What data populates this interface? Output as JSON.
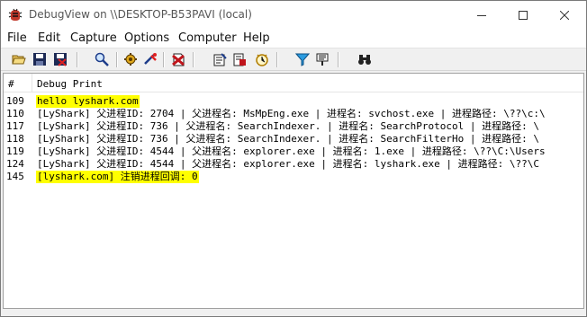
{
  "window": {
    "title": "DebugView on \\\\DESKTOP-B53PAVI (local)"
  },
  "menu": [
    "File",
    "Edit",
    "Capture",
    "Options",
    "Computer",
    "Help"
  ],
  "toolbar": {
    "buttons": [
      {
        "icon": "open-folder-icon"
      },
      {
        "icon": "save-icon"
      },
      {
        "icon": "save-as-icon"
      },
      {
        "icon": "find-icon"
      },
      {
        "icon": "capture-gear-icon"
      },
      {
        "icon": "capture-kernel-icon"
      },
      {
        "icon": "clear-icon"
      },
      {
        "icon": "properties-icon"
      },
      {
        "icon": "log-to-file-icon"
      },
      {
        "icon": "time-icon"
      },
      {
        "icon": "filter-icon"
      },
      {
        "icon": "highlight-icon"
      },
      {
        "icon": "binoculars-icon"
      }
    ]
  },
  "list": {
    "columns": [
      "#",
      "Debug Print"
    ],
    "rows": [
      {
        "num": "109",
        "text": "hello lyshark.com",
        "highlight": true
      },
      {
        "num": "110",
        "text": "[LyShark] 父进程ID: 2704 | 父进程名: MsMpEng.exe | 进程名: svchost.exe | 进程路径: \\??\\c:\\",
        "highlight": false
      },
      {
        "num": "117",
        "text": "[LyShark] 父进程ID: 736 | 父进程名: SearchIndexer. | 进程名: SearchProtocol | 进程路径: \\",
        "highlight": false
      },
      {
        "num": "118",
        "text": "[LyShark] 父进程ID: 736 | 父进程名: SearchIndexer. | 进程名: SearchFilterHo | 进程路径: \\",
        "highlight": false
      },
      {
        "num": "119",
        "text": "[LyShark] 父进程ID: 4544 | 父进程名: explorer.exe | 进程名: 1.exe | 进程路径: \\??\\C:\\Users",
        "highlight": false
      },
      {
        "num": "124",
        "text": "[LyShark] 父进程ID: 4544 | 父进程名: explorer.exe | 进程名: lyshark.exe | 进程路径: \\??\\C",
        "highlight": false
      },
      {
        "num": "145",
        "text": "[lyshark.com] 注销进程回调: 0",
        "highlight": true
      }
    ]
  },
  "colors": {
    "highlight": "#ffff00"
  }
}
